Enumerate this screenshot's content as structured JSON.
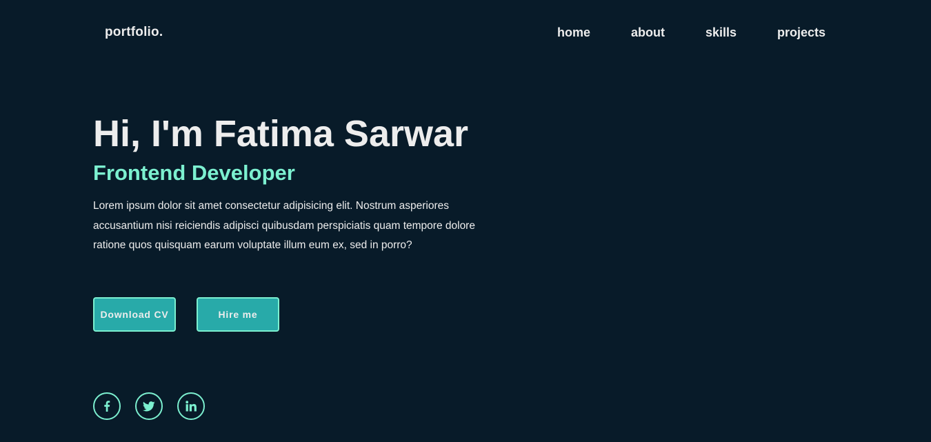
{
  "header": {
    "logo": "portfolio.",
    "nav": [
      {
        "label": "home"
      },
      {
        "label": "about"
      },
      {
        "label": "skills"
      },
      {
        "label": "projects"
      }
    ]
  },
  "hero": {
    "title": "Hi, I'm Fatima Sarwar",
    "subtitle": "Frontend Developer",
    "description": "Lorem ipsum dolor sit amet consectetur adipisicing elit. Nostrum asperiores accusantium nisi reiciendis adipisci quibusdam perspiciatis quam tempore dolore ratione quos quisquam earum voluptate illum eum ex, sed in porro?",
    "buttons": {
      "download_cv": "Download CV",
      "hire_me": "Hire me"
    }
  },
  "social": [
    {
      "icon": "facebook-icon"
    },
    {
      "icon": "twitter-icon"
    },
    {
      "icon": "linkedin-icon"
    }
  ],
  "colors": {
    "background": "#081b29",
    "accent": "#7cf0d0",
    "button_fill": "#28aaa9",
    "text": "#ededed"
  }
}
